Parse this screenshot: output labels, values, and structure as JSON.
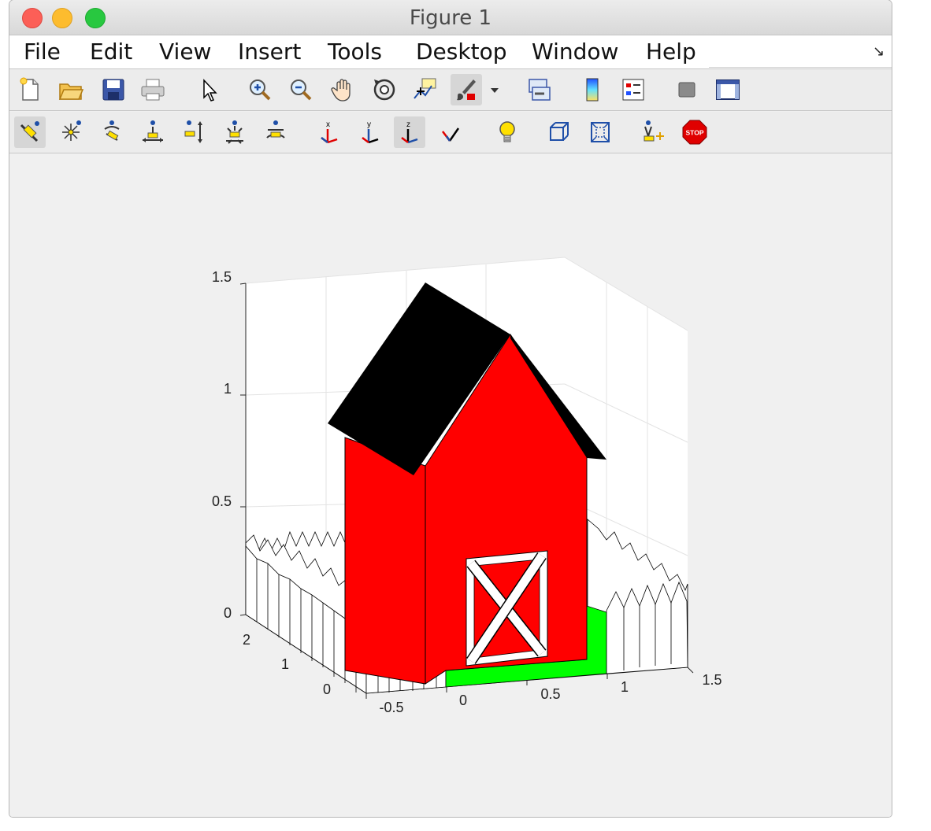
{
  "window": {
    "title": "Figure 1"
  },
  "menu": {
    "items": [
      {
        "label": "File"
      },
      {
        "label": "Edit"
      },
      {
        "label": "View"
      },
      {
        "label": "Insert"
      },
      {
        "label": "Tools"
      },
      {
        "label": "Desktop"
      },
      {
        "label": "Window"
      },
      {
        "label": "Help"
      }
    ]
  },
  "toolbar1": {
    "icons": [
      "new-figure-icon",
      "open-file-icon",
      "save-icon",
      "print-icon",
      "edit-plot-arrow-icon",
      "zoom-in-icon",
      "zoom-out-icon",
      "pan-hand-icon",
      "rotate-3d-icon",
      "data-cursor-icon",
      "brush-icon",
      "brush-dropdown-icon",
      "link-plot-icon",
      "colorbar-icon",
      "legend-icon",
      "hide-plot-tools-icon",
      "show-plot-tools-icon"
    ]
  },
  "toolbar2": {
    "icons": [
      "camera-orbit-icon",
      "orbit-scene-light-icon",
      "pan-tilt-camera-icon",
      "move-camera-horizontal-icon",
      "move-camera-forward-icon",
      "zoom-camera-icon",
      "roll-camera-icon",
      "x-principal-axis-icon",
      "y-principal-axis-icon",
      "z-principal-axis-icon",
      "no-principal-axis-icon",
      "toggle-scene-light-icon",
      "orthographic-projection-icon",
      "perspective-projection-icon",
      "reset-camera-icon",
      "stop-camera-icon"
    ]
  },
  "axes": {
    "z_ticks": [
      "0",
      "0.5",
      "1",
      "1.5"
    ],
    "x_ticks": [
      "-0.5",
      "0",
      "0.5",
      "1",
      "1.5"
    ],
    "y_ticks": [
      "0",
      "1",
      "2"
    ]
  },
  "scene": {
    "colors": {
      "barn": "#ff0000",
      "roof": "#000000",
      "ground": "#00ff00",
      "fence": "#ffffff",
      "door_frame": "#ffffff"
    }
  },
  "stop_label": "STOP"
}
